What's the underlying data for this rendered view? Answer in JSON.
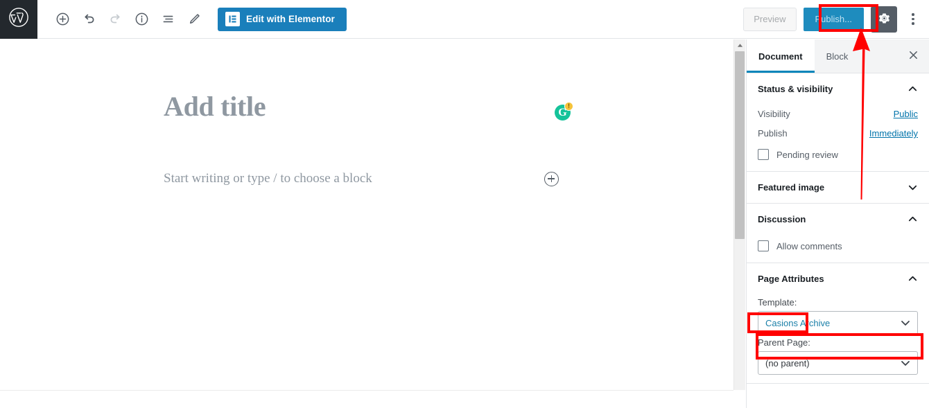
{
  "toolbar": {
    "logo_icon": "wordpress-logo",
    "icons": [
      {
        "name": "add-block-icon",
        "label": "Add block",
        "disabled": false
      },
      {
        "name": "undo-icon",
        "label": "Undo",
        "disabled": false
      },
      {
        "name": "redo-icon",
        "label": "Redo",
        "disabled": true
      },
      {
        "name": "content-info-icon",
        "label": "Content structure",
        "disabled": false
      },
      {
        "name": "block-navigation-icon",
        "label": "Block navigation",
        "disabled": false
      },
      {
        "name": "edit-pencil-icon",
        "label": "Edit",
        "disabled": false
      }
    ],
    "elementor_label": "Edit with Elementor",
    "elementor_color": "#1a7fbb",
    "preview_label": "Preview",
    "publish_label": "Publish...",
    "publish_color": "#1e8cbe",
    "settings_icon": "gear-icon",
    "more_icon": "kebab-menu-icon"
  },
  "editor": {
    "title_placeholder": "Add title",
    "paragraph_placeholder": "Start writing or type / to choose a block",
    "grammarly": {
      "letter": "G",
      "badge": "!",
      "color": "#15c39a",
      "badge_color": "#f5c33b"
    },
    "inserter_icon": "plus-circle-icon"
  },
  "sidebar": {
    "tabs": [
      {
        "label": "Document",
        "active": true
      },
      {
        "label": "Block",
        "active": false
      }
    ],
    "close_icon": "close-icon",
    "panels": [
      {
        "title": "Status & visibility",
        "expanded": true,
        "rows": [
          {
            "label": "Visibility",
            "value": "Public",
            "link": true
          },
          {
            "label": "Publish",
            "value": "Immediately",
            "link": true
          }
        ],
        "checkbox": {
          "label": "Pending review",
          "checked": false
        }
      },
      {
        "title": "Featured image",
        "expanded": false
      },
      {
        "title": "Discussion",
        "expanded": true,
        "checkbox": {
          "label": "Allow comments",
          "checked": false
        }
      },
      {
        "title": "Page Attributes",
        "expanded": true,
        "fields": [
          {
            "label": "Template:",
            "value": "Casions Archive",
            "highlighted": true
          },
          {
            "label": "Parent Page:",
            "value": "(no parent)",
            "highlighted": false
          }
        ]
      }
    ]
  },
  "annotations": {
    "color": "#ff0000",
    "boxes": [
      "publish-button",
      "template-label",
      "template-select"
    ],
    "arrow": "arrow-pointing-to-publish-button"
  }
}
